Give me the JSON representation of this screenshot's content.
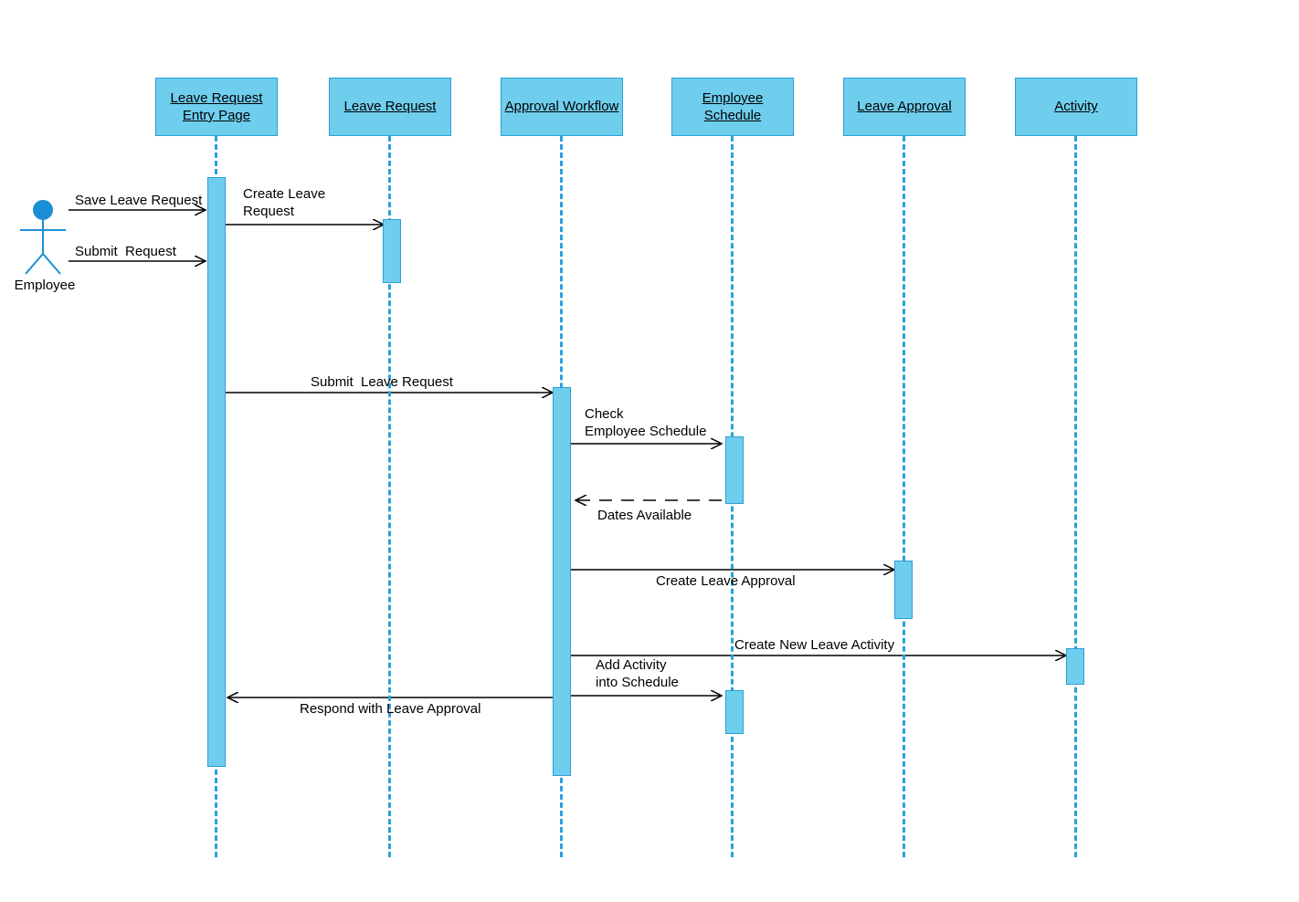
{
  "actor": {
    "label": "Employee"
  },
  "participants": {
    "p1": {
      "label": "Leave Request\nEntry Page"
    },
    "p2": {
      "label": "Leave Request"
    },
    "p3": {
      "label": "Approval\nWorkflow"
    },
    "p4": {
      "label": "Employee\nSchedule"
    },
    "p5": {
      "label": "Leave Approval"
    },
    "p6": {
      "label": "Activity"
    }
  },
  "messages": {
    "m1": {
      "label": "Save Leave Request"
    },
    "m2": {
      "label": "Submit  Request"
    },
    "m3": {
      "label": "Create Leave\nRequest"
    },
    "m4": {
      "label": "Submit  Leave Request"
    },
    "m5": {
      "label": "Check\nEmployee Schedule"
    },
    "m6": {
      "label": "Dates Available"
    },
    "m7": {
      "label": "Create Leave Approval"
    },
    "m8": {
      "label": "Create New Leave Activity"
    },
    "m9": {
      "label": "Add Activity\ninto Schedule"
    },
    "m10": {
      "label": "Respond with Leave Approval"
    }
  },
  "colors": {
    "fill": "#6fceee",
    "stroke": "#2a9fd6",
    "actorBlue": "#1b8fd5",
    "line": "#000"
  }
}
